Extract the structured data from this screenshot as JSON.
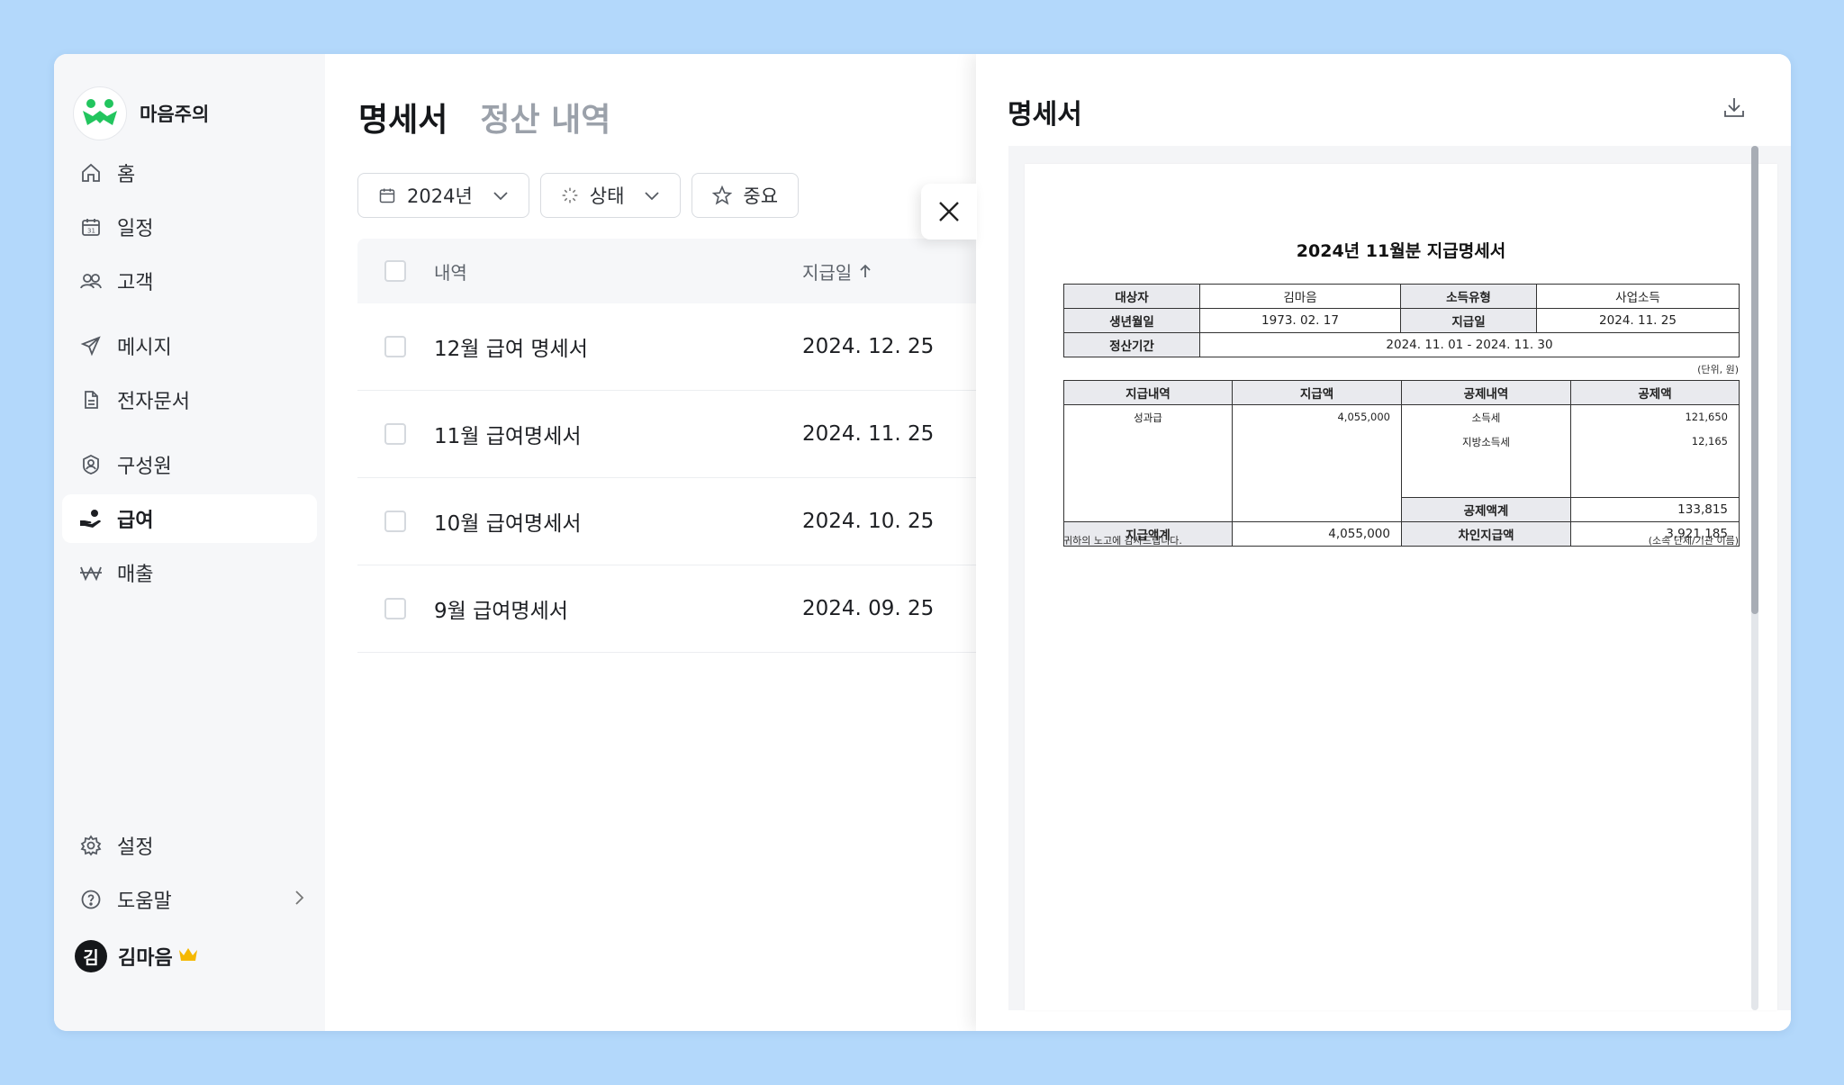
{
  "brand": {
    "name": "마음주의"
  },
  "sidebar": {
    "items": [
      {
        "label": "홈"
      },
      {
        "label": "일정"
      },
      {
        "label": "고객"
      },
      {
        "label": "메시지"
      },
      {
        "label": "전자문서"
      },
      {
        "label": "구성원"
      },
      {
        "label": "급여"
      },
      {
        "label": "매출"
      }
    ],
    "bottom": [
      {
        "label": "설정"
      },
      {
        "label": "도움말"
      }
    ]
  },
  "user": {
    "initial": "김",
    "name": "김마음"
  },
  "main": {
    "tabs": [
      {
        "label": "명세서"
      },
      {
        "label": "정산 내역"
      }
    ],
    "filters": {
      "year": "2024년",
      "status": "상태",
      "important": "중요"
    },
    "table": {
      "headers": {
        "item": "내역",
        "date": "지급일"
      },
      "rows": [
        {
          "title": "12월 급여 명세서",
          "date": "2024. 12. 25"
        },
        {
          "title": "11월 급여명세서",
          "date": "2024. 11. 25"
        },
        {
          "title": "10월 급여명세서",
          "date": "2024. 10. 25"
        },
        {
          "title": "9월 급여명세서",
          "date": "2024. 09. 25"
        }
      ]
    }
  },
  "panel": {
    "title": "명세서",
    "doc": {
      "title": "2024년 11월분 지급명세서",
      "info": {
        "target_label": "대상자",
        "target": "김마음",
        "income_type_label": "소득유형",
        "income_type": "사업소득",
        "birth_label": "생년월일",
        "birth": "1973. 02. 17",
        "pay_date_label": "지급일",
        "pay_date": "2024. 11. 25",
        "period_label": "정산기간",
        "period": "2024. 11. 01 - 2024. 11. 30"
      },
      "unit": "(단위, 원)",
      "pay": {
        "headers": [
          "지급내역",
          "지급액",
          "공제내역",
          "공제액"
        ],
        "earning_item": "성과급",
        "earning_amount": "4,055,000",
        "deductions": [
          {
            "item": "소득세",
            "amount": "121,650"
          },
          {
            "item": "지방소득세",
            "amount": "12,165"
          }
        ],
        "deduction_total_label": "공제액계",
        "deduction_total": "133,815",
        "pay_total_label": "지급액계",
        "pay_total": "4,055,000",
        "net_label": "차인지급액",
        "net": "3,921,185"
      },
      "footer_left": "귀하의 노고에 감사드립니다.",
      "footer_right": "(소속 단체/기관 이름)"
    }
  },
  "colors": {
    "background": "#b3d8fb",
    "brand": "#22c55e",
    "crown": "#f5b800"
  }
}
